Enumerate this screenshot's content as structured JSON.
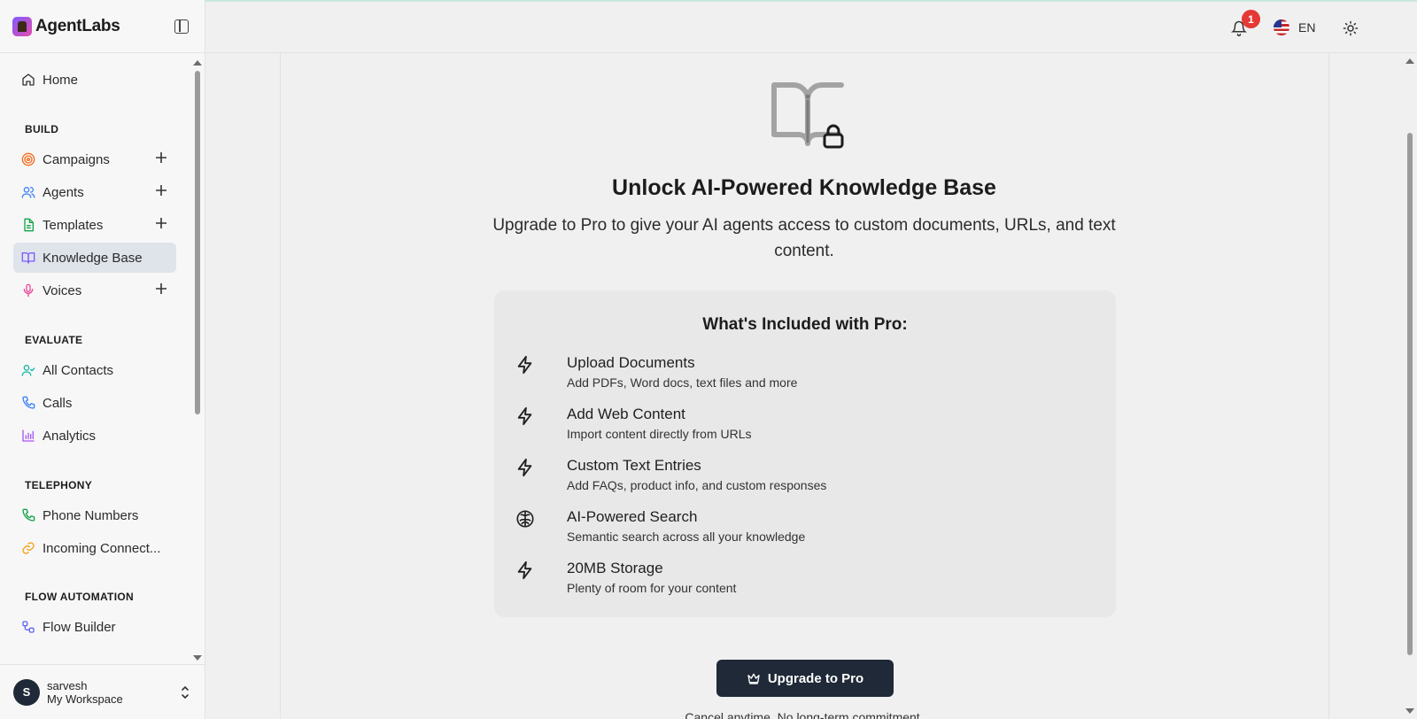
{
  "brand": {
    "name": "AgentLabs"
  },
  "sidebar": {
    "home": "Home",
    "sections": {
      "build": "BUILD",
      "evaluate": "EVALUATE",
      "telephony": "TELEPHONY",
      "flow": "FLOW AUTOMATION"
    },
    "items": {
      "campaigns": "Campaigns",
      "agents": "Agents",
      "templates": "Templates",
      "knowledge": "Knowledge Base",
      "voices": "Voices",
      "contacts": "All Contacts",
      "calls": "Calls",
      "analytics": "Analytics",
      "phone": "Phone Numbers",
      "incoming": "Incoming Connect...",
      "flow_builder": "Flow Builder"
    },
    "active": "knowledge"
  },
  "workspace": {
    "avatar_letter": "S",
    "user": "sarvesh",
    "name": "My Workspace"
  },
  "header": {
    "notification_count": "1",
    "language": "EN"
  },
  "main": {
    "title": "Unlock AI-Powered Knowledge Base",
    "subtitle": "Upgrade to Pro to give your AI agents access to custom documents, URLs, and text content.",
    "card_title": "What's Included with Pro:",
    "features": [
      {
        "icon": "zap-icon",
        "title": "Upload Documents",
        "desc": "Add PDFs, Word docs, text files and more"
      },
      {
        "icon": "zap-icon",
        "title": "Add Web Content",
        "desc": "Import content directly from URLs"
      },
      {
        "icon": "zap-icon",
        "title": "Custom Text Entries",
        "desc": "Add FAQs, product info, and custom responses"
      },
      {
        "icon": "brain-icon",
        "title": "AI-Powered Search",
        "desc": "Semantic search across all your knowledge"
      },
      {
        "icon": "zap-icon",
        "title": "20MB Storage",
        "desc": "Plenty of room for your content"
      }
    ],
    "upgrade_label": "Upgrade to Pro",
    "cancel_note": "Cancel anytime. No long-term commitment."
  },
  "colors": {
    "campaigns": "#f26b1d",
    "agents": "#3b82f6",
    "templates": "#16a34a",
    "knowledge": "#7c5cff",
    "voices": "#ec4899",
    "contacts": "#14b8a6",
    "calls": "#3b82f6",
    "analytics": "#a855f7",
    "phone": "#16a34a",
    "incoming": "#f59e0b",
    "flow": "#6366f1",
    "primary_button": "#1f2937",
    "badge": "#e53935"
  }
}
